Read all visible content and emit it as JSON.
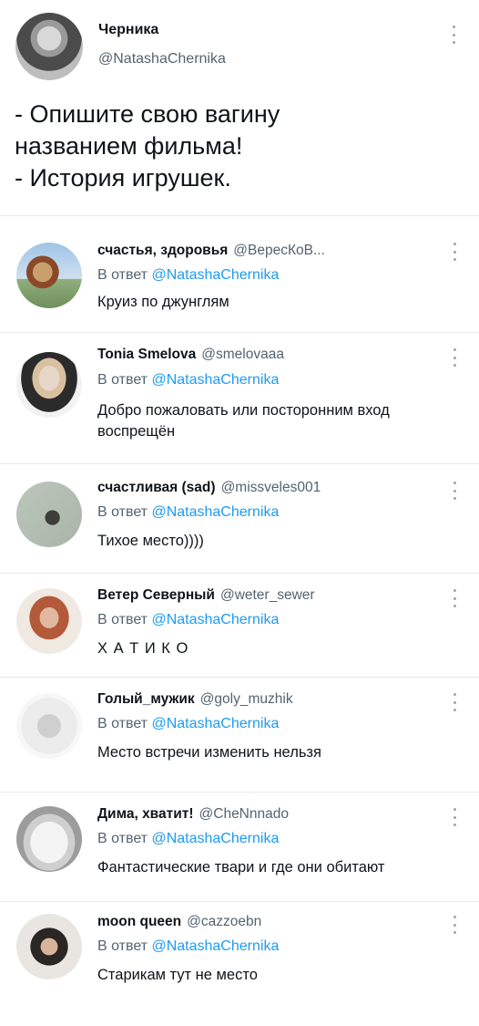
{
  "main": {
    "name": "Черника",
    "handle": "@NatashaChernika",
    "text": "- Опишите свою вагину\nназванием фильма!\n- История игрушек."
  },
  "reply_prefix": "В ответ",
  "replies": [
    {
      "name": "счастья, здоровья",
      "handle": "@ВересКоВ...",
      "mention": "@NatashaChernika",
      "text": "Круиз по джунглям"
    },
    {
      "name": "Tonia Smelova",
      "handle": "@smelovaaa",
      "mention": "@NatashaChernika",
      "text": "Добро пожаловать или посторонним вход воспрещён"
    },
    {
      "name": "счастливая (sad)",
      "handle": "@missveles001",
      "mention": "@NatashaChernika",
      "text": "Тихое место))))"
    },
    {
      "name": "Ветер Северный",
      "handle": "@weter_sewer",
      "mention": "@NatashaChernika",
      "text": "Х А Т И К О"
    },
    {
      "name": "Голый_мужик",
      "handle": "@goly_muzhik",
      "mention": "@NatashaChernika",
      "text": "Место встречи изменить нельзя"
    },
    {
      "name": "Дима, хватит!",
      "handle": "@CheNnnado",
      "mention": "@NatashaChernika",
      "text": "Фантастические твари и где они обитают"
    },
    {
      "name": "moon queen",
      "handle": "@cazzoebn",
      "mention": "@NatashaChernika",
      "text": "Старикам тут не место"
    }
  ]
}
